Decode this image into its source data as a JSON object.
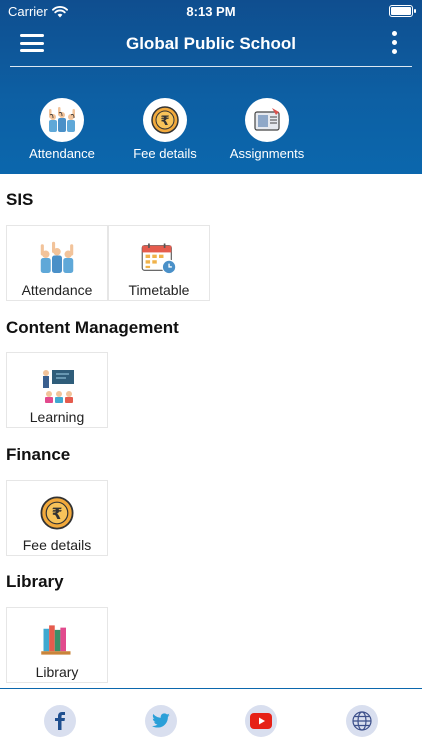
{
  "status_bar": {
    "carrier": "Carrier",
    "time": "8:13 PM"
  },
  "app_bar": {
    "title": "Global Public School"
  },
  "quick_actions": [
    {
      "label": "Attendance",
      "icon": "raised-hands-icon"
    },
    {
      "label": "Fee details",
      "icon": "rupee-coin-icon"
    },
    {
      "label": "Assignments",
      "icon": "assignment-icon"
    }
  ],
  "sections": [
    {
      "title": "SIS",
      "tiles": [
        {
          "label": "Attendance",
          "icon": "raised-hands-icon"
        },
        {
          "label": "Timetable",
          "icon": "calendar-clock-icon"
        }
      ]
    },
    {
      "title": "Content Management",
      "tiles": [
        {
          "label": "Learning",
          "icon": "classroom-icon"
        }
      ]
    },
    {
      "title": "Finance",
      "tiles": [
        {
          "label": "Fee details",
          "icon": "rupee-coin-icon"
        }
      ]
    },
    {
      "title": "Library",
      "tiles": [
        {
          "label": "Library",
          "icon": "books-icon"
        }
      ]
    }
  ],
  "social_links": [
    {
      "icon": "facebook-icon"
    },
    {
      "icon": "twitter-icon"
    },
    {
      "icon": "youtube-icon"
    },
    {
      "icon": "globe-icon"
    }
  ],
  "colors": {
    "header": "#0d5fa3",
    "accent": "#0b67ad",
    "tile_border": "#e6e6e6",
    "social_bg": "#d9dfef"
  }
}
